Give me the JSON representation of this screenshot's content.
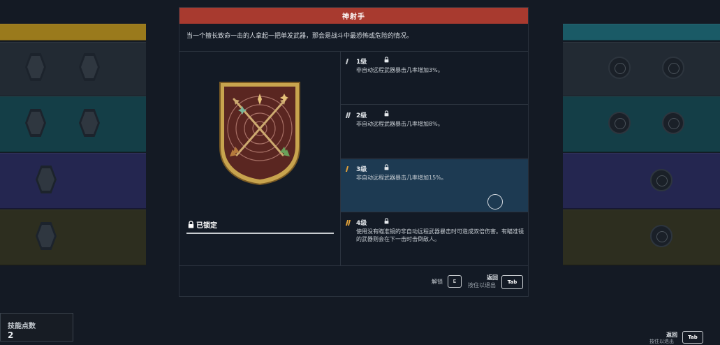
{
  "modal": {
    "title": "神射手",
    "description": "当一个擅长致命一击的人拿起一把单发武器，那会是战斗中最恐怖或危险的情况。"
  },
  "badge": {
    "icon": "crossed-arrows-target-badge",
    "status": "已锁定"
  },
  "levels": [
    {
      "name": "1级",
      "desc": "非自动远程武器暴击几率增加3%。",
      "locked": true,
      "bars": 1,
      "bar_color": "#c8ccd0"
    },
    {
      "name": "2级",
      "desc": "非自动远程武器暴击几率增加8%。",
      "locked": true,
      "bars": 2,
      "bar_color": "#c8ccd0"
    },
    {
      "name": "3级",
      "desc": "非自动远程武器暴击几率增加15%。",
      "locked": true,
      "bars": 1,
      "bar_color": "#e2a23a"
    },
    {
      "name": "4级",
      "desc": "使用没有瞄准镜的非自动远程武器暴击时可造成双倍伤害。有瞄准镜的武器则会在下一击时击倒敌人。",
      "locked": true,
      "bars": 2,
      "bar_color": "#e2a23a"
    }
  ],
  "footer": {
    "unlock_label": "解锁",
    "unlock_key": "E",
    "back_label": "返回",
    "hold_label": "按住以退出",
    "tab_key": "Tab"
  },
  "skill_points": {
    "label": "技能点数",
    "value": "2"
  },
  "bottom_right": {
    "back_label": "返回",
    "hold_label": "按住以退出",
    "tab_key": "Tab"
  },
  "colors": {
    "header": "#a83a2f",
    "active_level": "#1d3a52",
    "band_gold": "#9a7a1c",
    "band_teal": "#1a5a66",
    "band_purple": "#2a2c5c",
    "band_olive": "#3a3a20"
  }
}
